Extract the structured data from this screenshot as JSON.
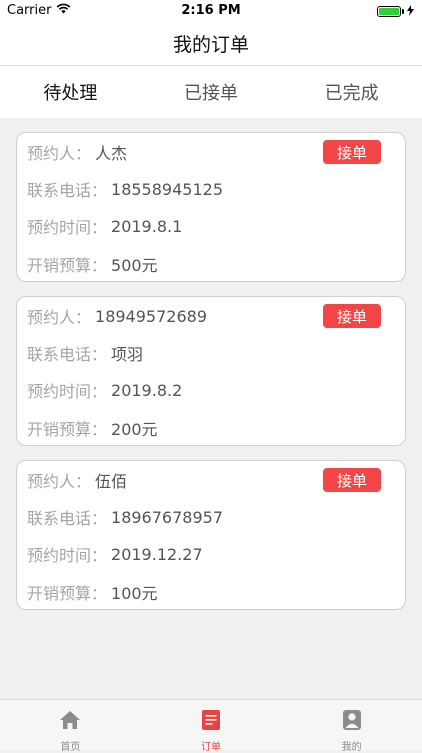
{
  "status_bar": {
    "carrier": "Carrier",
    "time": "2:16 PM"
  },
  "nav": {
    "title": "我的订单"
  },
  "tabs": [
    {
      "label": "待处理",
      "active": true
    },
    {
      "label": "已接单",
      "active": false
    },
    {
      "label": "已完成",
      "active": false
    }
  ],
  "orders": [
    {
      "booker_label": "预约人：",
      "booker": "人杰",
      "phone_label": "联系电话：",
      "phone": "18558945125",
      "time_label": "预约时间：",
      "time": "2019.8.1",
      "budget_label": "开销预算：",
      "budget": "500元",
      "accept_label": "接单"
    },
    {
      "booker_label": "预约人：",
      "booker": "18949572689",
      "phone_label": "联系电话：",
      "phone": "项羽",
      "time_label": "预约时间：",
      "time": "2019.8.2",
      "budget_label": "开销预算：",
      "budget": "200元",
      "accept_label": "接单"
    },
    {
      "booker_label": "预约人：",
      "booker": "伍佰",
      "phone_label": "联系电话：",
      "phone": "18967678957",
      "time_label": "预约时间：",
      "time": "2019.12.27",
      "budget_label": "开销预算：",
      "budget": "100元",
      "accept_label": "接单"
    }
  ],
  "bottom_nav": [
    {
      "label": "首页",
      "icon": "home-icon",
      "active": false
    },
    {
      "label": "订单",
      "icon": "orders-icon",
      "active": true
    },
    {
      "label": "我的",
      "icon": "profile-icon",
      "active": false
    }
  ],
  "colors": {
    "accent": "#f24646",
    "background": "#f0f0f0",
    "battery": "#2fcf3d"
  }
}
